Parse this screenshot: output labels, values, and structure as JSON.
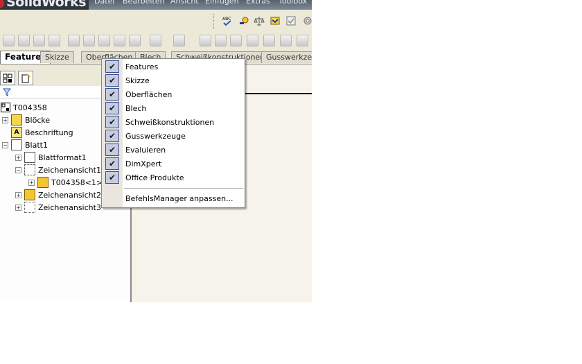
{
  "app": {
    "logo": "SolidWorks",
    "menu": [
      "Datei",
      "Bearbeiten",
      "Ansicht",
      "Einfügen",
      "Extras",
      "Toolbox"
    ]
  },
  "tabs": [
    "Features",
    "Skizze",
    "Oberflächen",
    "Blech",
    "Schweißkonstruktionen",
    "Gusswerkzeuge"
  ],
  "tree": {
    "root": "T004358",
    "items": [
      {
        "label": "Blöcke"
      },
      {
        "label": "Beschriftung"
      },
      {
        "label": "Blatt1"
      },
      {
        "label": "Blattformat1"
      },
      {
        "label": "Zeichenansicht1"
      },
      {
        "label": "T004358<1>"
      },
      {
        "label": "Zeichenansicht2"
      },
      {
        "label": "Zeichenansicht3"
      }
    ]
  },
  "context_menu": {
    "items": [
      {
        "label": "Features",
        "checked": true
      },
      {
        "label": "Skizze",
        "checked": true
      },
      {
        "label": "Oberflächen",
        "checked": true
      },
      {
        "label": "Blech",
        "checked": true
      },
      {
        "label": "Schweißkonstruktionen",
        "checked": true
      },
      {
        "label": "Gusswerkzeuge",
        "checked": true
      },
      {
        "label": "Evaluieren",
        "checked": true
      },
      {
        "label": "DimXpert",
        "checked": true
      },
      {
        "label": "Office Produkte",
        "checked": true
      }
    ],
    "customize": "BefehlsManager anpassen..."
  },
  "icons": {
    "filter": "filter-icon",
    "spellcheck": "spellcheck-icon",
    "check": "checkmark-icon"
  },
  "colors": {
    "menubar": "#6f7b8a",
    "check_bg": "#c6cbe0",
    "canvas": "#f6f4ea"
  }
}
